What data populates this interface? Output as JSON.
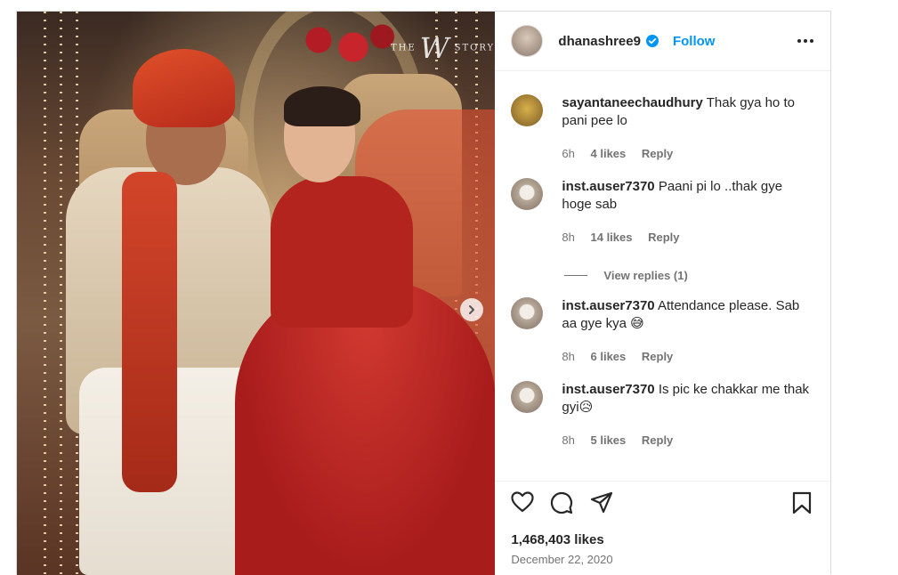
{
  "post": {
    "author": {
      "username": "dhanashree9",
      "verified": true,
      "follow_label": "Follow"
    },
    "image": {
      "watermark_left": "THE",
      "watermark_mark": "W",
      "watermark_right": "STORY"
    },
    "comments": [
      {
        "username": "sayantaneechaudhury",
        "text": "Thak gya ho to pani pee lo",
        "time": "6h",
        "likes": "4 likes",
        "reply": "Reply"
      },
      {
        "username": "inst.auser7370",
        "text": "Paani pi lo ..thak gye hoge sab",
        "time": "8h",
        "likes": "14 likes",
        "reply": "Reply"
      },
      {
        "username": "inst.auser7370",
        "text": "Attendance please. Sab aa gye kya 😅",
        "time": "8h",
        "likes": "6 likes",
        "reply": "Reply"
      },
      {
        "username": "inst.auser7370",
        "text": "Is pic ke chakkar me thak gyi😥",
        "time": "8h",
        "likes": "5 likes",
        "reply": "Reply"
      }
    ],
    "view_replies_label": "View replies (1)",
    "likes_count": "1,468,403 likes",
    "date": "December 22, 2020",
    "colors": {
      "accent": "#0095f6",
      "text": "#262626",
      "muted": "#737373",
      "border": "#dbdbdb"
    },
    "icons": [
      "verified-badge-icon",
      "more-options-icon",
      "like-heart-icon",
      "comment-icon",
      "share-icon",
      "save-bookmark-icon",
      "next-arrow-icon"
    ]
  }
}
